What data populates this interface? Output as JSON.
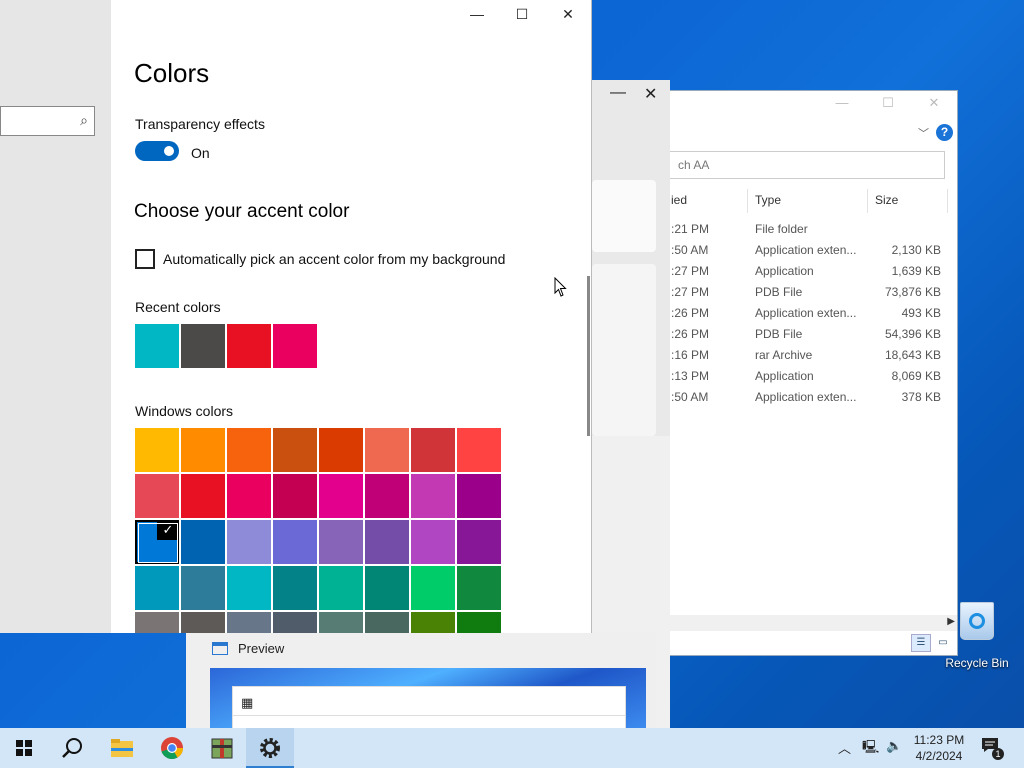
{
  "settings": {
    "title": "Colors",
    "transparency_label": "Transparency effects",
    "transparency_state": "On",
    "accent_heading": "Choose your accent color",
    "auto_pick_label": "Automatically pick an accent color from my background",
    "recent_label": "Recent colors",
    "windows_colors_label": "Windows colors",
    "recent_colors": [
      "#00b7c3",
      "#4c4a48",
      "#e81123",
      "#ea005e"
    ],
    "windows_colors": [
      "#ffb900",
      "#ff8c00",
      "#f7630c",
      "#ca5010",
      "#da3b01",
      "#ef6950",
      "#d13438",
      "#ff4343",
      "#e74856",
      "#e81123",
      "#ea005e",
      "#c30052",
      "#e3008c",
      "#bf0077",
      "#c239b3",
      "#9a0089",
      "#0078d7",
      "#0063b1",
      "#8e8cd8",
      "#6b69d6",
      "#8764b8",
      "#744da9",
      "#b146c2",
      "#881798",
      "#0099bc",
      "#2d7d9a",
      "#00b7c3",
      "#038387",
      "#00b294",
      "#018574",
      "#00cc6a",
      "#10893e",
      "#7a7574",
      "#5d5a58",
      "#68768a",
      "#515c6b",
      "#567c73",
      "#486860",
      "#498205",
      "#107c10"
    ],
    "selected_index": 16,
    "checkmark": "✓"
  },
  "explorer": {
    "search_placeholder": "ch AA",
    "headers": {
      "date": "ied",
      "type": "Type",
      "size": "Size"
    },
    "rows": [
      {
        "date": ":21 PM",
        "type": "File folder",
        "size": ""
      },
      {
        "date": ":50 AM",
        "type": "Application exten...",
        "size": "2,130 KB"
      },
      {
        "date": ":27 PM",
        "type": "Application",
        "size": "1,639 KB"
      },
      {
        "date": ":27 PM",
        "type": "PDB File",
        "size": "73,876 KB"
      },
      {
        "date": ":26 PM",
        "type": "Application exten...",
        "size": "493 KB"
      },
      {
        "date": ":26 PM",
        "type": "PDB File",
        "size": "54,396 KB"
      },
      {
        "date": ":16 PM",
        "type": "rar Archive",
        "size": "18,643 KB"
      },
      {
        "date": ":13 PM",
        "type": "Application",
        "size": "8,069 KB"
      },
      {
        "date": ":50 AM",
        "type": "Application exten...",
        "size": "378 KB"
      }
    ]
  },
  "preview": {
    "title": "Preview"
  },
  "desktop": {
    "recycle_label": "Recycle Bin"
  },
  "taskbar": {
    "time": "11:23 PM",
    "date": "4/2/2024",
    "notification_count": "1",
    "accent": "#2f7fd0"
  }
}
